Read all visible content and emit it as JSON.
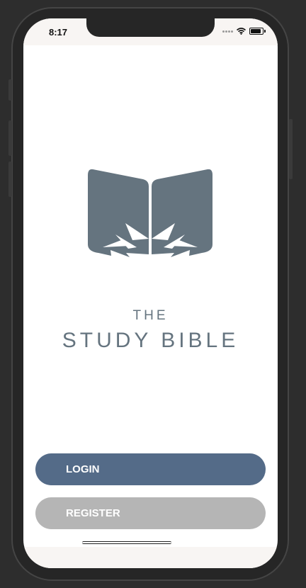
{
  "status_bar": {
    "time": "8:17",
    "icons": [
      "signal-icon",
      "wifi-icon",
      "battery-icon"
    ]
  },
  "brand": {
    "logo_icon": "open-book-icon",
    "the_text": "THE",
    "name_text": "STUDY BIBLE",
    "color": "#65747f"
  },
  "actions": {
    "login_label": "LOGIN",
    "register_label": "REGISTER"
  },
  "colors": {
    "login_button": "#546b88",
    "register_button": "#b5b5b5",
    "logo": "#65747f",
    "status_bar_bg": "#f8f5f3"
  }
}
